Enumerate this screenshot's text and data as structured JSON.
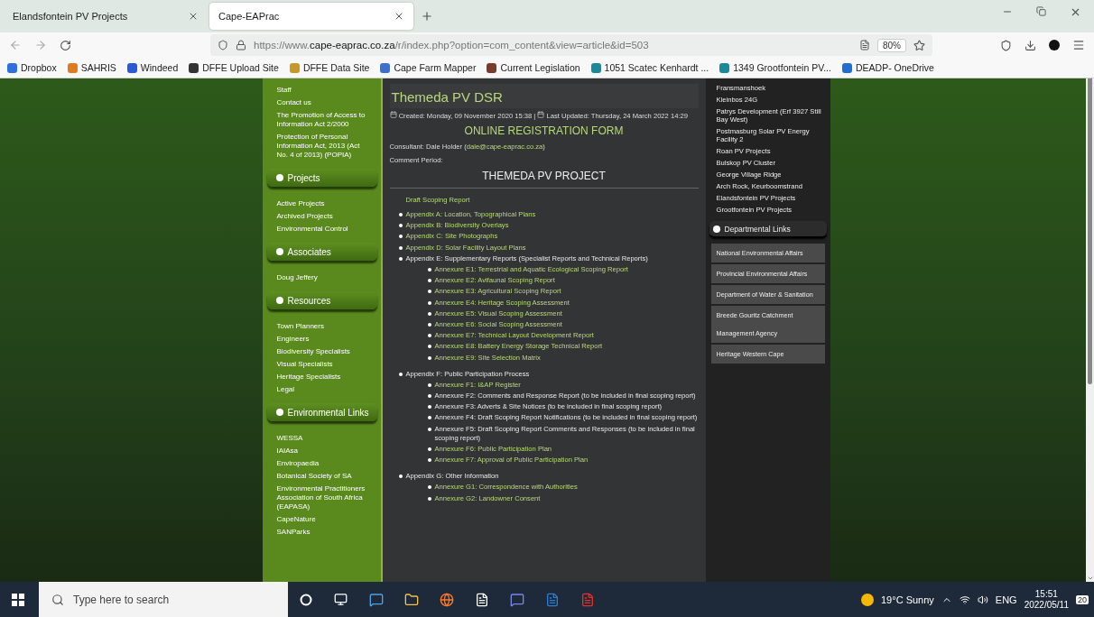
{
  "browser": {
    "tabs": [
      {
        "title": "Elandsfontein PV Projects",
        "selected": false
      },
      {
        "title": "Cape-EAPrac",
        "selected": true
      }
    ],
    "url_prefix": "https://www.",
    "url_domain": "cape-eaprac.co.za",
    "url_rest": "/r/index.php?option=com_content&view=article&id=503",
    "zoom": "80%",
    "bookmarks": [
      {
        "label": "Dropbox",
        "color": "#2f6fe0"
      },
      {
        "label": "SAHRIS",
        "color": "#e07a1f"
      },
      {
        "label": "Windeed",
        "color": "#2a5bd7"
      },
      {
        "label": "DFFE Upload Site",
        "color": "#333333"
      },
      {
        "label": "DFFE Data Site",
        "color": "#c9962a"
      },
      {
        "label": "Cape Farm Mapper",
        "color": "#3d6fd1"
      },
      {
        "label": "Current Legislation",
        "color": "#7a3b2a"
      },
      {
        "label": "1051 Scatec Kenhardt ...",
        "color": "#1a8a9a"
      },
      {
        "label": "1349 Grootfontein PV...",
        "color": "#1a8a9a"
      },
      {
        "label": "DEADP- OneDrive",
        "color": "#1f6fd0"
      }
    ]
  },
  "left_menu": {
    "top_links": [
      "Staff",
      "Contact us",
      "The Promotion of Access to Information Act 2/2000",
      "Protection of Personal Information Act, 2013 (Act No. 4 of 2013) (POPIA)"
    ],
    "sections": [
      {
        "title": "Projects",
        "items": [
          "Active Projects",
          "Archived Projects",
          "Environmental Control"
        ]
      },
      {
        "title": "Associates",
        "items": [
          "Doug Jeffery"
        ]
      },
      {
        "title": "Resources",
        "items": [
          "Town Planners",
          "Engineers",
          "Biodiversity Specialists",
          "Visual Specialists",
          "Heritage Specialists",
          "Legal"
        ]
      },
      {
        "title": "Environmental Links",
        "items": [
          "WESSA",
          "IAIAsa",
          "Enviropaedia",
          "Botanical Society of SA",
          "Environmental Practitioners Association of South Africa (EAPASA)",
          "CapeNature",
          "SANParks"
        ]
      }
    ]
  },
  "article": {
    "title": "Themeda PV DSR",
    "meta": [
      "Created: Monday, 09 November 2020 15:38 |",
      "Last Updated: Thursday, 24 March 2022 14:29"
    ],
    "form_heading": "ONLINE REGISTRATION FORM",
    "consultant_prefix": "Consultant: Dale Holder (",
    "consultant_email": "dale@cape-eaprac.co.za",
    "consultant_suffix": ")",
    "comment_label": "Comment Period:",
    "project_heading": "THEMEDA PV PROJECT",
    "report_title": "Draft Scoping Report",
    "appendices": [
      {
        "label": "Appendix A: Location, Topographical Plans",
        "linked": true
      },
      {
        "label": "Appendix B:  Biodiversity Overlays",
        "linked": true
      },
      {
        "label": "Appendix C:  Site Photographs",
        "linked": true
      },
      {
        "label": "Appendix D:  Solar Facility Layout Plans",
        "linked": true
      },
      {
        "label": "Appendix E:  Supplementary Reports (Specialist Reports and Technical Reports)",
        "linked": false,
        "children": [
          {
            "label": "Annexure E1:  Terrestrial and Aquatic Ecological Scoping Report",
            "linked": true
          },
          {
            "label": "Annexure E2:  Avifaunal Scoping Report",
            "linked": true
          },
          {
            "label": "Annexure E3:  Agricultural Scoping Report",
            "linked": true
          },
          {
            "label": "Annexure E4:  Heritage Scoping Assessment",
            "linked": true
          },
          {
            "label": "Annexure E5:  Visual Scoping Assessment",
            "linked": true
          },
          {
            "label": "Annexure E6:  Social Scoping Assessment",
            "linked": true
          },
          {
            "label": "Annexure E7:  Technical Layout Development Report",
            "linked": true
          },
          {
            "label": "Annexure E8:  Battery Energy Storage Technical Report",
            "linked": true
          },
          {
            "label": "Annexure E9: Site Selection Matrix",
            "linked": true
          }
        ]
      },
      {
        "label": "Appendix F: Public Participation Process",
        "linked": false,
        "children": [
          {
            "label": "Annexure F1:  I&AP Register",
            "linked": true
          },
          {
            "label": "Annexure F2:  Comments and Response Report (to be included in final scoping report)",
            "linked": false
          },
          {
            "label": "Annexure F3:  Adverts & Site Notices (to be included in final scoping report)",
            "linked": false
          },
          {
            "label": "Annexure F4:  Draft Scoping Report Notifications (to be included in final scoping report)",
            "linked": false
          },
          {
            "label": "Annexure F5:  Draft Scoping Report Comments and Responses (to be included in final scoping report)",
            "linked": false
          },
          {
            "label": "Annexure F6:  Public Participation Plan",
            "linked": true
          },
          {
            "label": "Annexure F7:  Approval of Public Participation Plan",
            "linked": true
          }
        ]
      },
      {
        "label": "Appendix G:  Other Information",
        "linked": false,
        "children": [
          {
            "label": "Annexure G1:  Correspondence with Authorities",
            "linked": true
          },
          {
            "label": "Annexure G2:  Landowner Consent",
            "linked": true
          }
        ]
      }
    ]
  },
  "right_menu": {
    "project_links": [
      "Fransmanshoek",
      "Kleinbos 24G",
      "Patrys Development (Erf 3927 Still Bay West)",
      "Postmasburg Solar PV Energy Facility 2",
      "Roan PV Projects",
      "Bulskop PV Cluster",
      "George Village Ridge",
      "Arch Rock, Keurboomstrand",
      "Elandsfontein PV Projects",
      "Grootfontein PV Projects"
    ],
    "dept_title": "Departmental Links",
    "dept_links": [
      {
        "lines": [
          "National Environmental Affairs"
        ]
      },
      {
        "lines": [
          "Provincial Environmental Affairs"
        ]
      },
      {
        "lines": [
          "Department of Water & Sanitation"
        ]
      },
      {
        "lines": [
          "Breede Gouritz Catchment",
          "Management Agency"
        ]
      },
      {
        "lines": [
          "Heritage Western Cape"
        ]
      }
    ]
  },
  "taskbar": {
    "search_placeholder": "Type here to search",
    "weather": "19°C Sunny",
    "language": "ENG",
    "time": "15:51",
    "date": "2022/05/11",
    "notifications": "20"
  }
}
